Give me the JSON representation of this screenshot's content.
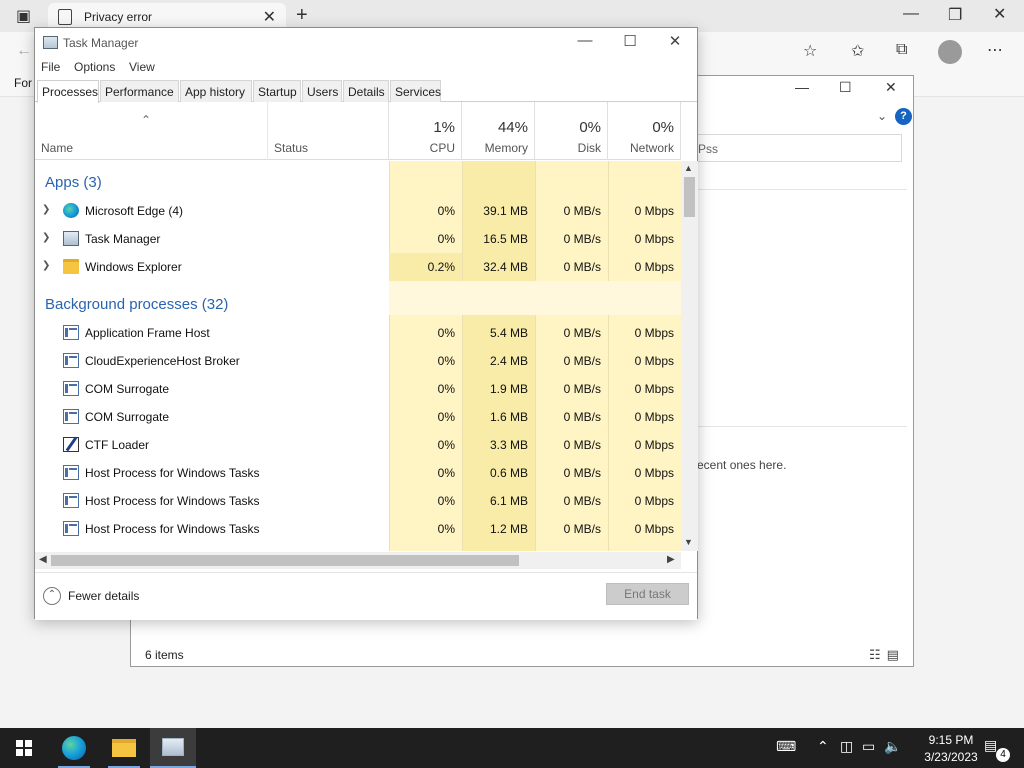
{
  "edge": {
    "tab_title": "Privacy error",
    "favbar_partial": "For"
  },
  "explorer": {
    "search_placeholder_partial": "Pss",
    "recent_text_partial": "ecent ones here.",
    "status_items": "6 items"
  },
  "taskmgr": {
    "window_title": "Task Manager",
    "menu": [
      "File",
      "Options",
      "View"
    ],
    "tabs": [
      "Processes",
      "Performance",
      "App history",
      "Startup",
      "Users",
      "Details",
      "Services"
    ],
    "active_tab": "Processes",
    "columns": {
      "name": "Name",
      "status": "Status",
      "cpu": {
        "pct": "1%",
        "label": "CPU"
      },
      "memory": {
        "pct": "44%",
        "label": "Memory"
      },
      "disk": {
        "pct": "0%",
        "label": "Disk"
      },
      "network": {
        "pct": "0%",
        "label": "Network"
      }
    },
    "groups": {
      "apps": "Apps (3)",
      "background": "Background processes (32)"
    },
    "apps": [
      {
        "name": "Microsoft Edge (4)",
        "icon": "edge-icon",
        "cpu": "0%",
        "memory": "39.1 MB",
        "disk": "0 MB/s",
        "network": "0 Mbps"
      },
      {
        "name": "Task Manager",
        "icon": "task-manager-icon",
        "cpu": "0%",
        "memory": "16.5 MB",
        "disk": "0 MB/s",
        "network": "0 Mbps"
      },
      {
        "name": "Windows Explorer",
        "icon": "folder-icon",
        "cpu": "0.2%",
        "memory": "32.4 MB",
        "disk": "0 MB/s",
        "network": "0 Mbps"
      }
    ],
    "background": [
      {
        "name": "Application Frame Host",
        "cpu": "0%",
        "memory": "5.4 MB",
        "disk": "0 MB/s",
        "network": "0 Mbps"
      },
      {
        "name": "CloudExperienceHost Broker",
        "cpu": "0%",
        "memory": "2.4 MB",
        "disk": "0 MB/s",
        "network": "0 Mbps"
      },
      {
        "name": "COM Surrogate",
        "cpu": "0%",
        "memory": "1.9 MB",
        "disk": "0 MB/s",
        "network": "0 Mbps"
      },
      {
        "name": "COM Surrogate",
        "cpu": "0%",
        "memory": "1.6 MB",
        "disk": "0 MB/s",
        "network": "0 Mbps"
      },
      {
        "name": "CTF Loader",
        "cpu": "0%",
        "memory": "3.3 MB",
        "disk": "0 MB/s",
        "network": "0 Mbps"
      },
      {
        "name": "Host Process for Windows Tasks",
        "cpu": "0%",
        "memory": "0.6 MB",
        "disk": "0 MB/s",
        "network": "0 Mbps"
      },
      {
        "name": "Host Process for Windows Tasks",
        "cpu": "0%",
        "memory": "6.1 MB",
        "disk": "0 MB/s",
        "network": "0 Mbps"
      },
      {
        "name": "Host Process for Windows Tasks",
        "cpu": "0%",
        "memory": "1.2 MB",
        "disk": "0 MB/s",
        "network": "0 Mbps"
      }
    ],
    "fewer_details": "Fewer details",
    "end_task": "End task"
  },
  "taskbar": {
    "time": "9:15 PM",
    "date": "3/23/2023",
    "notification_count": "4"
  },
  "colors": {
    "heat_light": "#fff4c4",
    "heat_medium": "#f9eca8",
    "group_blue": "#2a64b0",
    "taskbar": "#1f1f1f"
  }
}
